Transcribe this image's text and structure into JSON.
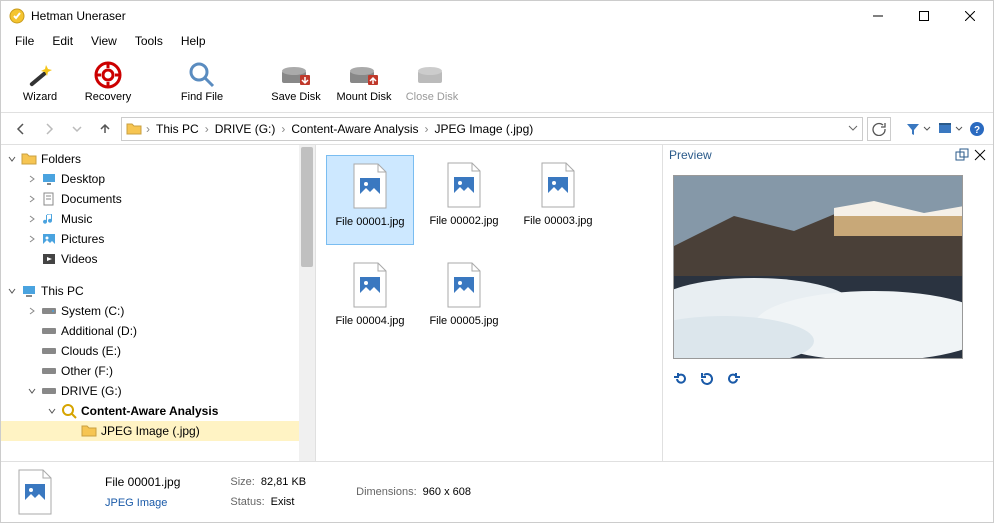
{
  "app": {
    "title": "Hetman Uneraser"
  },
  "menu": [
    "File",
    "Edit",
    "View",
    "Tools",
    "Help"
  ],
  "toolbar": [
    {
      "label": "Wizard",
      "icon": "wand"
    },
    {
      "label": "Recovery",
      "icon": "lifebuoy"
    },
    {
      "label": "Find File",
      "icon": "magnifier",
      "gap": true
    },
    {
      "label": "Save Disk",
      "icon": "disk-save"
    },
    {
      "label": "Mount Disk",
      "icon": "disk-mount"
    },
    {
      "label": "Close Disk",
      "icon": "disk-close",
      "disabled": true
    }
  ],
  "breadcrumb": [
    "This PC",
    "DRIVE (G:)",
    "Content-Aware Analysis",
    "JPEG Image (.jpg)"
  ],
  "tree": {
    "root1": "Folders",
    "root1_items": [
      "Desktop",
      "Documents",
      "Music",
      "Pictures",
      "Videos"
    ],
    "root2": "This PC",
    "root2_items": [
      "System (C:)",
      "Additional (D:)",
      "Clouds (E:)",
      "Other (F:)",
      "DRIVE (G:)"
    ],
    "caa": "Content-Aware Analysis",
    "jpeg": "JPEG Image (.jpg)"
  },
  "files": [
    "File 00001.jpg",
    "File 00002.jpg",
    "File 00003.jpg",
    "File 00004.jpg",
    "File 00005.jpg"
  ],
  "preview": {
    "title": "Preview"
  },
  "status": {
    "filename": "File 00001.jpg",
    "type": "JPEG Image",
    "size_label": "Size:",
    "size_value": "82,81 KB",
    "status_label": "Status:",
    "status_value": "Exist",
    "dim_label": "Dimensions:",
    "dim_value": "960 x 608"
  }
}
